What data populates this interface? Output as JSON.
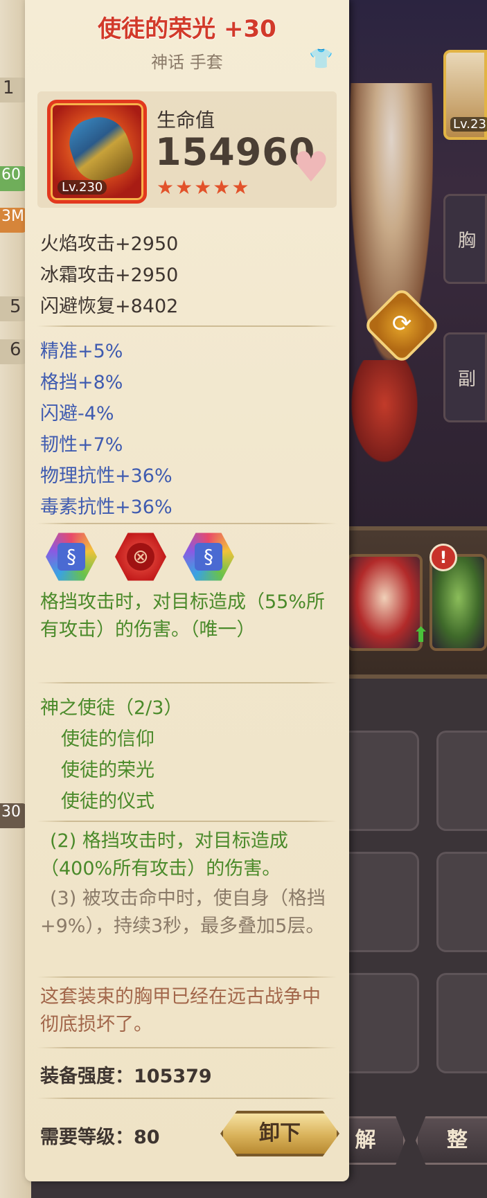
{
  "item": {
    "name": "使徒的荣光 +30",
    "type": "神话 手套",
    "level_badge": "Lv.230",
    "hp_label": "生命值",
    "hp_value": "154960",
    "stars": "★★★★★"
  },
  "base_stats": [
    "火焰攻击+2950",
    "冰霜攻击+2950",
    "闪避恢复+8402"
  ],
  "bonus_stats": [
    "精准+5%",
    "格挡+8%",
    "闪避-4%",
    "韧性+7%",
    "物理抗性+36%",
    "毒素抗性+36%"
  ],
  "gems": [
    "rainbow",
    "red",
    "rainbow"
  ],
  "unique_effect": "格挡攻击时，对目标造成（55%所有攻击）的伤害。（唯一）",
  "set": {
    "title": "神之使徒（2/3）",
    "items": [
      "使徒的信仰",
      "使徒的荣光",
      "使徒的仪式"
    ],
    "bonus_2": "(2) 格挡攻击时，对目标造成（400%所有攻击）的伤害。",
    "bonus_3": "(3) 被攻击命中时，使自身（格挡+9%），持续3秒，最多叠加5层。"
  },
  "flavor": "这套装束的胸甲已经在远古战争中彻底损坏了。",
  "strength_label": "装备强度：",
  "strength_value": "105379",
  "req_level_label": "需要等级：",
  "req_level_value": "80",
  "unequip_label": "卸下",
  "background": {
    "right_card_level": "Lv.23",
    "right_slot_1": "胸",
    "right_slot_2": "副",
    "bottom_btn_1": "解",
    "bottom_btn_2": "整",
    "left_numbers": [
      "1",
      "60",
      "3M",
      "5",
      "6",
      "30"
    ]
  },
  "colors": {
    "title_red": "#d23a2a",
    "stat_blue": "#3f5bb0",
    "effect_green": "#4a8a2a",
    "flavor_brown": "#a2664a",
    "parchment": "#f3e8cf"
  }
}
